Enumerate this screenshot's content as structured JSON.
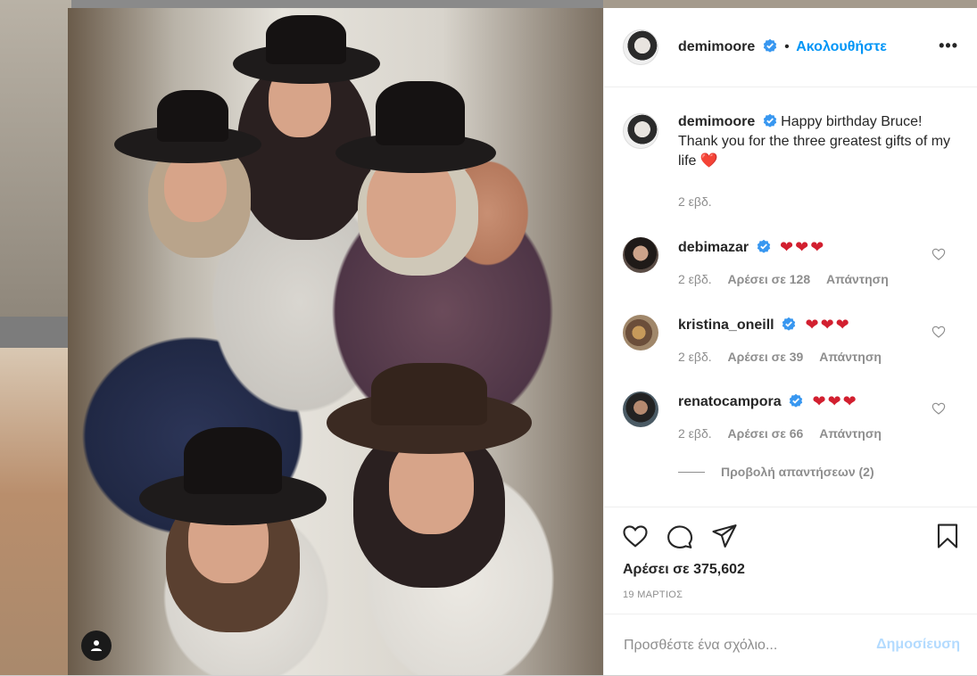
{
  "post": {
    "username": "demimoore",
    "follow_label": "Ακολουθήστε",
    "bullet": "•",
    "more_label": "•••",
    "caption": "Happy birthday Bruce! Thank you for the three greatest gifts of my life",
    "caption_emoji": "❤️",
    "caption_time": "2 εβδ."
  },
  "comments": [
    {
      "username": "debimazar",
      "text": "❤❤❤",
      "time": "2 εβδ.",
      "likes": "Αρέσει σε 128",
      "reply": "Απάντηση"
    },
    {
      "username": "kristina_oneill",
      "text": "❤❤❤",
      "time": "2 εβδ.",
      "likes": "Αρέσει σε 39",
      "reply": "Απάντηση"
    },
    {
      "username": "renatocampora",
      "text": "❤❤❤",
      "time": "2 εβδ.",
      "likes": "Αρέσει σε 66",
      "reply": "Απάντηση",
      "view_replies": "Προβολή απαντήσεων (2)"
    }
  ],
  "partial_comment": {
    "text": "❤❤❤"
  },
  "footer": {
    "likes": "Αρέσει σε 375,602",
    "date": "19 ΜΑΡΤΙΟΣ",
    "comment_placeholder": "Προσθέστε ένα σχόλιο...",
    "post_label": "Δημοσίευση"
  },
  "colors": {
    "accent": "#0095f6",
    "verified": "#3897f0",
    "heart": "#d21f2f",
    "post_disabled": "#b3dbff"
  },
  "icons": {
    "photo_tag": "user-icon",
    "like": "heart-icon",
    "comment": "comment-icon",
    "share": "paper-plane-icon",
    "save": "bookmark-icon"
  }
}
